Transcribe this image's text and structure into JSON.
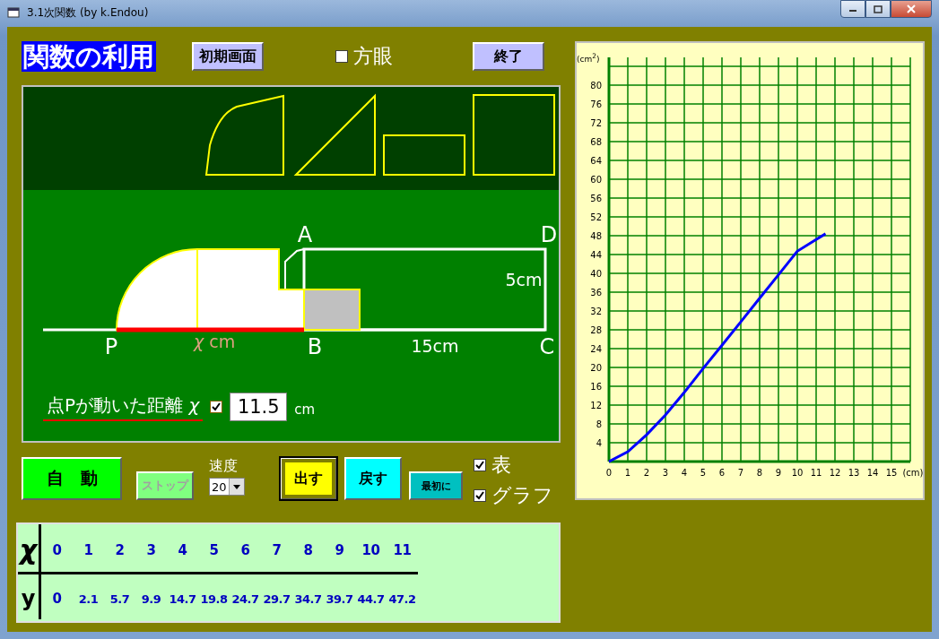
{
  "window": {
    "title": "3.1次関数 (by k.Endou)"
  },
  "header": {
    "title": "関数の利用",
    "reset_button": "初期画面",
    "grid_checkbox": {
      "label": "方眼",
      "checked": false
    },
    "quit_button": "終了"
  },
  "canvas": {
    "vertex_a": "A",
    "vertex_b": "B",
    "vertex_c": "C",
    "vertex_d": "D",
    "point_p": "P",
    "height_label": "5cm",
    "base_label": "15cm",
    "distance_mark": "*χ* cm",
    "distance": {
      "label": "点Pが動いた距離 *χ*",
      "checked": true,
      "value": "11.5",
      "unit": "cm"
    }
  },
  "controls": {
    "auto_button": "自　動",
    "stop_button": {
      "label": "ストップ",
      "disabled": true
    },
    "speed": {
      "label": "速度",
      "value": "20"
    },
    "show_button": {
      "label": "出す",
      "focused": true
    },
    "back_button": "戻す",
    "first_button": "最初に",
    "table_checkbox": {
      "label": "表",
      "checked": true
    },
    "graph_checkbox": {
      "label": "グラフ",
      "checked": true
    }
  },
  "table": {
    "x_label": "χ",
    "y_label": "y",
    "x_values": [
      "0",
      "1",
      "2",
      "3",
      "4",
      "5",
      "6",
      "7",
      "8",
      "9",
      "10",
      "11"
    ],
    "y_values": [
      "0",
      "2.1",
      "5.7",
      "9.9",
      "14.7",
      "19.8",
      "24.7",
      "29.7",
      "34.7",
      "39.7",
      "44.7",
      "47.2"
    ]
  },
  "graph": {
    "chart_data": {
      "type": "line",
      "grid": true,
      "xlabel": "(cm)",
      "ylabel": "(cm$^{2}$)",
      "xlim": [
        0,
        16
      ],
      "ylim": [
        0,
        84
      ],
      "xticks": [
        0,
        1,
        2,
        3,
        4,
        5,
        6,
        7,
        8,
        9,
        10,
        11,
        12,
        13,
        14,
        15
      ],
      "yticks": [
        4,
        8,
        12,
        16,
        20,
        24,
        28,
        32,
        36,
        40,
        44,
        48,
        52,
        56,
        60,
        64,
        68,
        72,
        76,
        80
      ],
      "x": [
        0,
        1,
        2,
        3,
        4,
        5,
        6,
        7,
        8,
        9,
        10,
        11,
        11.5
      ],
      "series": [
        {
          "color": "#0000ff",
          "values": [
            0,
            2.1,
            5.7,
            9.9,
            14.7,
            19.8,
            24.7,
            29.7,
            34.7,
            39.7,
            44.7,
            47.2,
            48.4
          ]
        }
      ]
    }
  }
}
